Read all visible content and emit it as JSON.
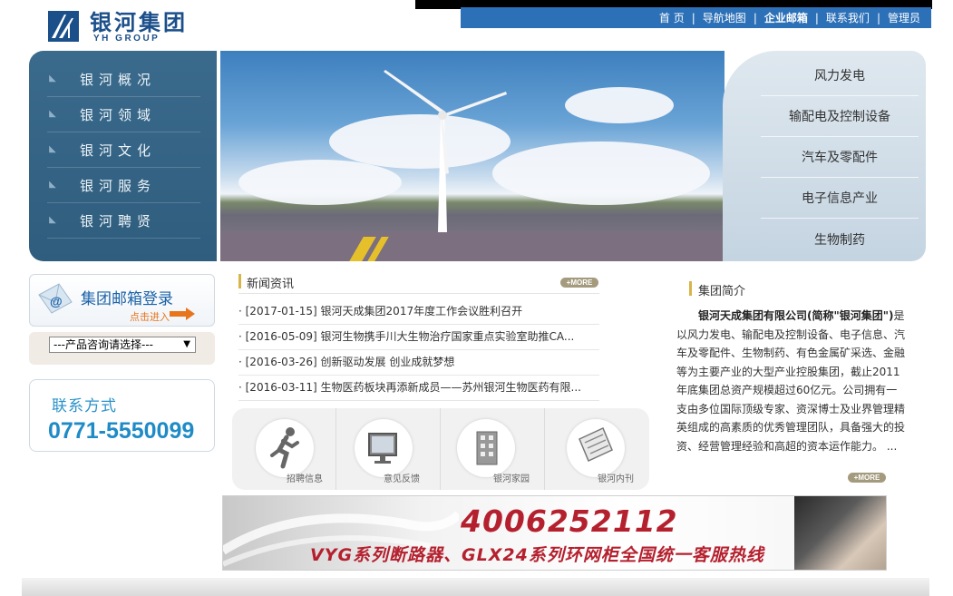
{
  "header": {
    "logo_cn": "银河集团",
    "logo_en": "YH GROUP",
    "nav": [
      {
        "label": "首 页",
        "bold": false
      },
      {
        "label": "导航地图",
        "bold": false
      },
      {
        "label": "企业邮箱",
        "bold": true
      },
      {
        "label": "联系我们",
        "bold": false
      },
      {
        "label": "管理员",
        "bold": false
      }
    ]
  },
  "left_menu": [
    {
      "label": "银河概况"
    },
    {
      "label": "银河领域"
    },
    {
      "label": "银河文化"
    },
    {
      "label": "银河服务"
    },
    {
      "label": "银河聘贤"
    }
  ],
  "categories": [
    {
      "label": "风力发电"
    },
    {
      "label": "输配电及控制设备"
    },
    {
      "label": "汽车及零配件"
    },
    {
      "label": "电子信息产业"
    },
    {
      "label": "生物制药"
    }
  ],
  "mail_login": {
    "title": "集团邮箱登录",
    "enter": "点击进入"
  },
  "product_select": {
    "selected": "---产品咨询请选择---"
  },
  "contact": {
    "title": "联系方式",
    "phone": "0771-5550099"
  },
  "news": {
    "title": "新闻资讯",
    "more": "+MORE",
    "items": [
      {
        "text": "· [2017-01-15] 银河天成集团2017年度工作会议胜利召开"
      },
      {
        "text": "· [2016-05-09] 银河生物携手川大生物治疗国家重点实验室助推CA..."
      },
      {
        "text": "· [2016-03-26] 创新驱动发展 创业成就梦想"
      },
      {
        "text": "· [2016-03-11] 生物医药板块再添新成员——苏州银河生物医药有限..."
      }
    ]
  },
  "quick_links": [
    {
      "label": "招聘信息",
      "icon": "runner-icon"
    },
    {
      "label": "意见反馈",
      "icon": "monitor-icon"
    },
    {
      "label": "银河家园",
      "icon": "building-icon"
    },
    {
      "label": "银河内刊",
      "icon": "document-icon"
    }
  ],
  "intro": {
    "title": "集团简介",
    "company": "银河天成集团有限公司(简称\"银河集团\")",
    "body": "是以风力发电、输配电及控制设备、电子信息、汽车及零配件、生物制药、有色金属矿采选、金融等为主要产业的大型产业控股集团，截止2011年底集团总资产规模超过60亿元。公司拥有一支由多位国际顶级专家、资深博士及业界管理精英组成的高素质的优秀管理团队，具备强大的投资、经营管理经验和高超的资本运作能力。 ...",
    "more": "+MORE"
  },
  "hotline": {
    "number": "4006252112",
    "text": "VYG系列断路器、GLX24系列环网柜全国统一客服热线"
  },
  "colors": {
    "nav_blue": "#2c70b7",
    "menu_blue": "#2f5d7e",
    "accent_gold": "#d8b548",
    "hotline_red": "#b5202e",
    "contact_blue": "#1f8bc6"
  }
}
